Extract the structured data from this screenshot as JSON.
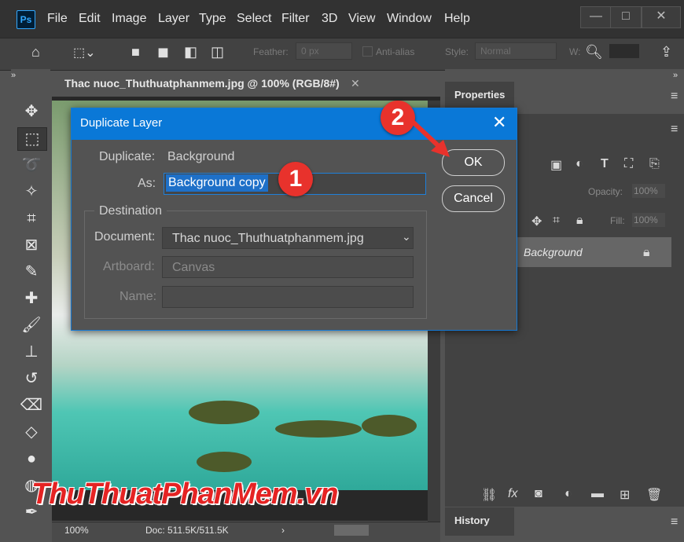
{
  "app": {
    "logo": "Ps"
  },
  "menu": [
    "File",
    "Edit",
    "Image",
    "Layer",
    "Type",
    "Select",
    "Filter",
    "3D",
    "View",
    "Window",
    "Help"
  ],
  "window_controls": {
    "minimize": "—",
    "maximize": "□",
    "close": "✕"
  },
  "options_bar": {
    "feather_label": "Feather:",
    "feather_value": "0 px",
    "antialias_label": "Anti-alias",
    "style_label": "Style:",
    "style_value": "Normal",
    "w_label": "W:"
  },
  "document": {
    "tab_title": "Thac nuoc_Thuthuatphanmem.jpg @ 100% (RGB/8#)",
    "zoom": "100%",
    "doc_size": "Doc: 511.5K/511.5K"
  },
  "panels": {
    "properties": "Properties",
    "history": "History",
    "opacity_label": "Opacity:",
    "opacity_value": "100%",
    "fill_label": "Fill:",
    "fill_value": "100%",
    "layer_name": "Background"
  },
  "dialog": {
    "title": "Duplicate Layer",
    "duplicate_label": "Duplicate:",
    "duplicate_value": "Background",
    "as_label": "As:",
    "as_value": "Background copy",
    "destination_label": "Destination",
    "document_label": "Document:",
    "document_value": "Thac nuoc_Thuthuatphanmem.jpg",
    "artboard_label": "Artboard:",
    "artboard_value": "Canvas",
    "name_label": "Name:",
    "ok_label": "OK",
    "cancel_label": "Cancel"
  },
  "callouts": {
    "one": "1",
    "two": "2"
  },
  "watermark": "ThuThuatPhanMem.vn",
  "colors": {
    "dialog_titlebar": "#0a78d7",
    "callout": "#e8322c",
    "selection": "#1e70c8"
  }
}
